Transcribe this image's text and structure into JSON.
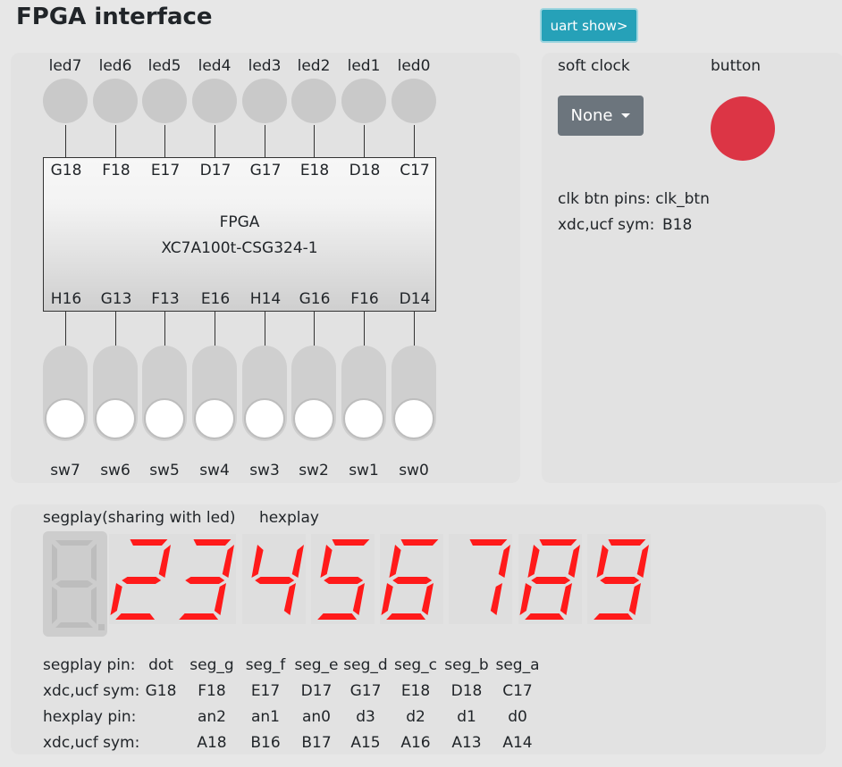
{
  "header": {
    "title": "FPGA interface",
    "uart_button": "uart show>"
  },
  "leds": [
    {
      "label": "led7",
      "pin": "G18"
    },
    {
      "label": "led6",
      "pin": "F18"
    },
    {
      "label": "led5",
      "pin": "E17"
    },
    {
      "label": "led4",
      "pin": "D17"
    },
    {
      "label": "led3",
      "pin": "G17"
    },
    {
      "label": "led2",
      "pin": "E18"
    },
    {
      "label": "led1",
      "pin": "D18"
    },
    {
      "label": "led0",
      "pin": "C17"
    }
  ],
  "chip": {
    "name": "FPGA",
    "model": "XC7A100t-CSG324-1"
  },
  "switches": [
    {
      "label": "sw7",
      "pin": "H16"
    },
    {
      "label": "sw6",
      "pin": "G13"
    },
    {
      "label": "sw5",
      "pin": "F13"
    },
    {
      "label": "sw4",
      "pin": "E16"
    },
    {
      "label": "sw3",
      "pin": "H14"
    },
    {
      "label": "sw2",
      "pin": "G16"
    },
    {
      "label": "sw1",
      "pin": "F16"
    },
    {
      "label": "sw0",
      "pin": "D14"
    }
  ],
  "side": {
    "soft_clock_label": "soft clock",
    "button_label": "button",
    "dropdown_value": "None",
    "clk_pins": "clk btn pins: clk_btn",
    "xdc_label": "xdc,ucf sym:",
    "xdc_value": "B18",
    "button_color": "#dc3545"
  },
  "segment": {
    "segplay_title": "segplay(sharing with led)",
    "hexplay_title": "hexplay",
    "digits": [
      "2",
      "3",
      "4",
      "5",
      "6",
      "7",
      "8",
      "9"
    ],
    "lit_color": "#ff1a1a",
    "rows": [
      {
        "label": "segplay pin:",
        "values": [
          "dot",
          "seg_g",
          "seg_f",
          "seg_e",
          "seg_d",
          "seg_c",
          "seg_b",
          "seg_a"
        ]
      },
      {
        "label": "xdc,ucf sym:",
        "values": [
          "G18",
          "F18",
          "E17",
          "D17",
          "G17",
          "E18",
          "D18",
          "C17"
        ]
      },
      {
        "label": "hexplay pin:",
        "values": [
          "",
          "an2",
          "an1",
          "an0",
          "d3",
          "d2",
          "d1",
          "d0"
        ]
      },
      {
        "label": "xdc,ucf sym:",
        "values": [
          "",
          "A18",
          "B16",
          "B17",
          "A15",
          "A16",
          "A13",
          "A14"
        ]
      }
    ]
  }
}
